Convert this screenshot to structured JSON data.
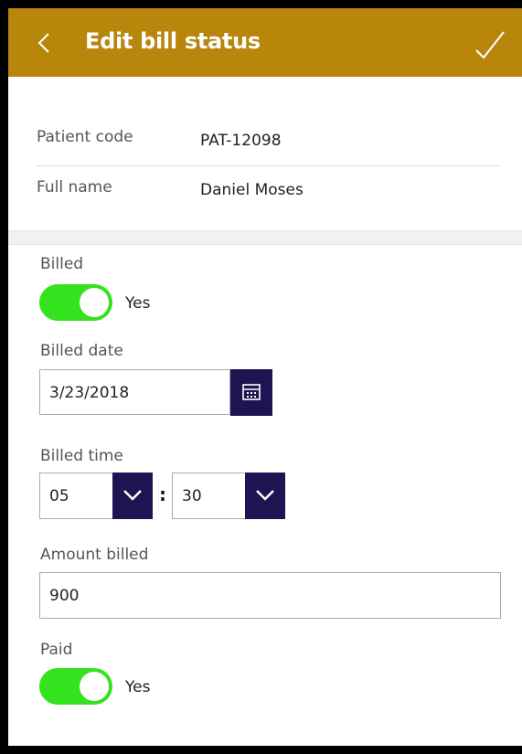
{
  "header": {
    "title": "Edit bill status",
    "back_icon": "chevron-left-icon",
    "save_icon": "checkmark-icon",
    "background": "#b8860b"
  },
  "patient": {
    "code_label": "Patient code",
    "code_value": "PAT-12098",
    "name_label": "Full name",
    "name_value": "Daniel Moses"
  },
  "form": {
    "billed": {
      "label": "Billed",
      "state_text": "Yes",
      "on": true
    },
    "billed_date": {
      "label": "Billed date",
      "value": "3/23/2018",
      "icon": "calendar-icon"
    },
    "billed_time": {
      "label": "Billed time",
      "hour": "05",
      "separator": ":",
      "minute": "30"
    },
    "amount_billed": {
      "label": "Amount billed",
      "value": "900"
    },
    "paid": {
      "label": "Paid",
      "state_text": "Yes",
      "on": true
    }
  },
  "colors": {
    "toggle_on": "#34e21e",
    "control_accent": "#1f1352"
  }
}
